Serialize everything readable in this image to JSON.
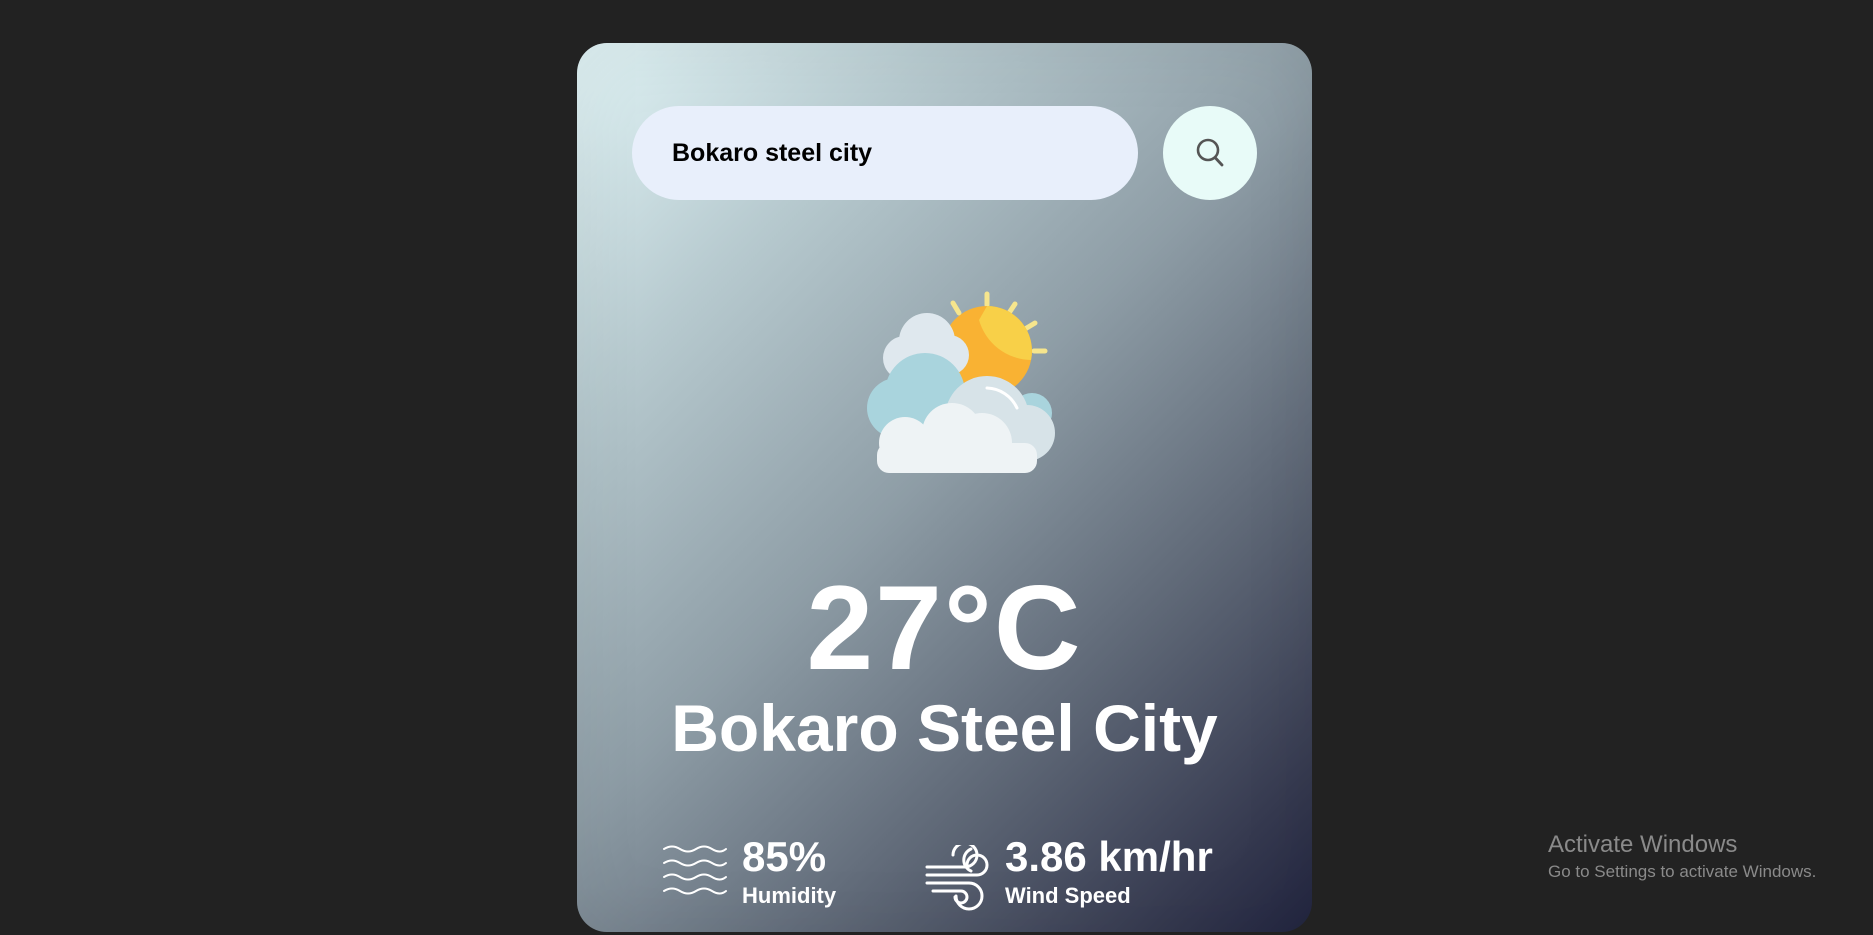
{
  "search": {
    "value": "Bokaro steel city",
    "icon": "search-icon"
  },
  "weather": {
    "icon": "partly-cloudy-icon",
    "temperature": "27°C",
    "city": "Bokaro Steel City"
  },
  "details": {
    "humidity": {
      "icon": "humidity-waves-icon",
      "value": "85%",
      "label": "Humidity"
    },
    "wind": {
      "icon": "wind-icon",
      "value": "3.86 km/hr",
      "label": "Wind Speed"
    }
  },
  "watermark": {
    "title": "Activate Windows",
    "subtitle": "Go to Settings to activate Windows."
  },
  "colors": {
    "page_background": "#222222",
    "search_background": "#e8effb",
    "button_background": "#e8fbf8",
    "text": "#ffffff",
    "sun": "#f9b233"
  }
}
